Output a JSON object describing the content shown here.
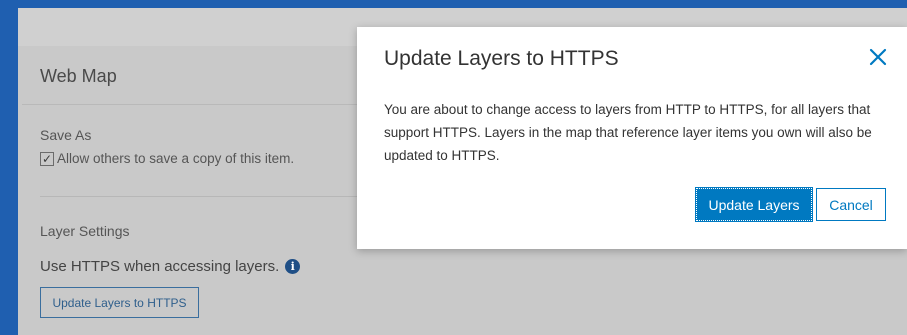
{
  "background": {
    "title": "Web Map",
    "save_as": "Save As",
    "allow_copy_label": "Allow others to save a copy of this item.",
    "allow_copy_checked": true,
    "layer_settings": "Layer Settings",
    "https_text": "Use HTTPS when accessing layers.",
    "update_button": "Update Layers to HTTPS"
  },
  "modal": {
    "title": "Update Layers to HTTPS",
    "body": "You are about to change access to layers from HTTP to HTTPS, for all layers that support HTTPS. Layers in the map that reference layer items you own will also be updated to HTTPS.",
    "primary_button": "Update Layers",
    "secondary_button": "Cancel"
  },
  "colors": {
    "accent": "#0079c1",
    "overlay_bg": "#c9c9c9",
    "page_bg": "#1f5fb0"
  }
}
